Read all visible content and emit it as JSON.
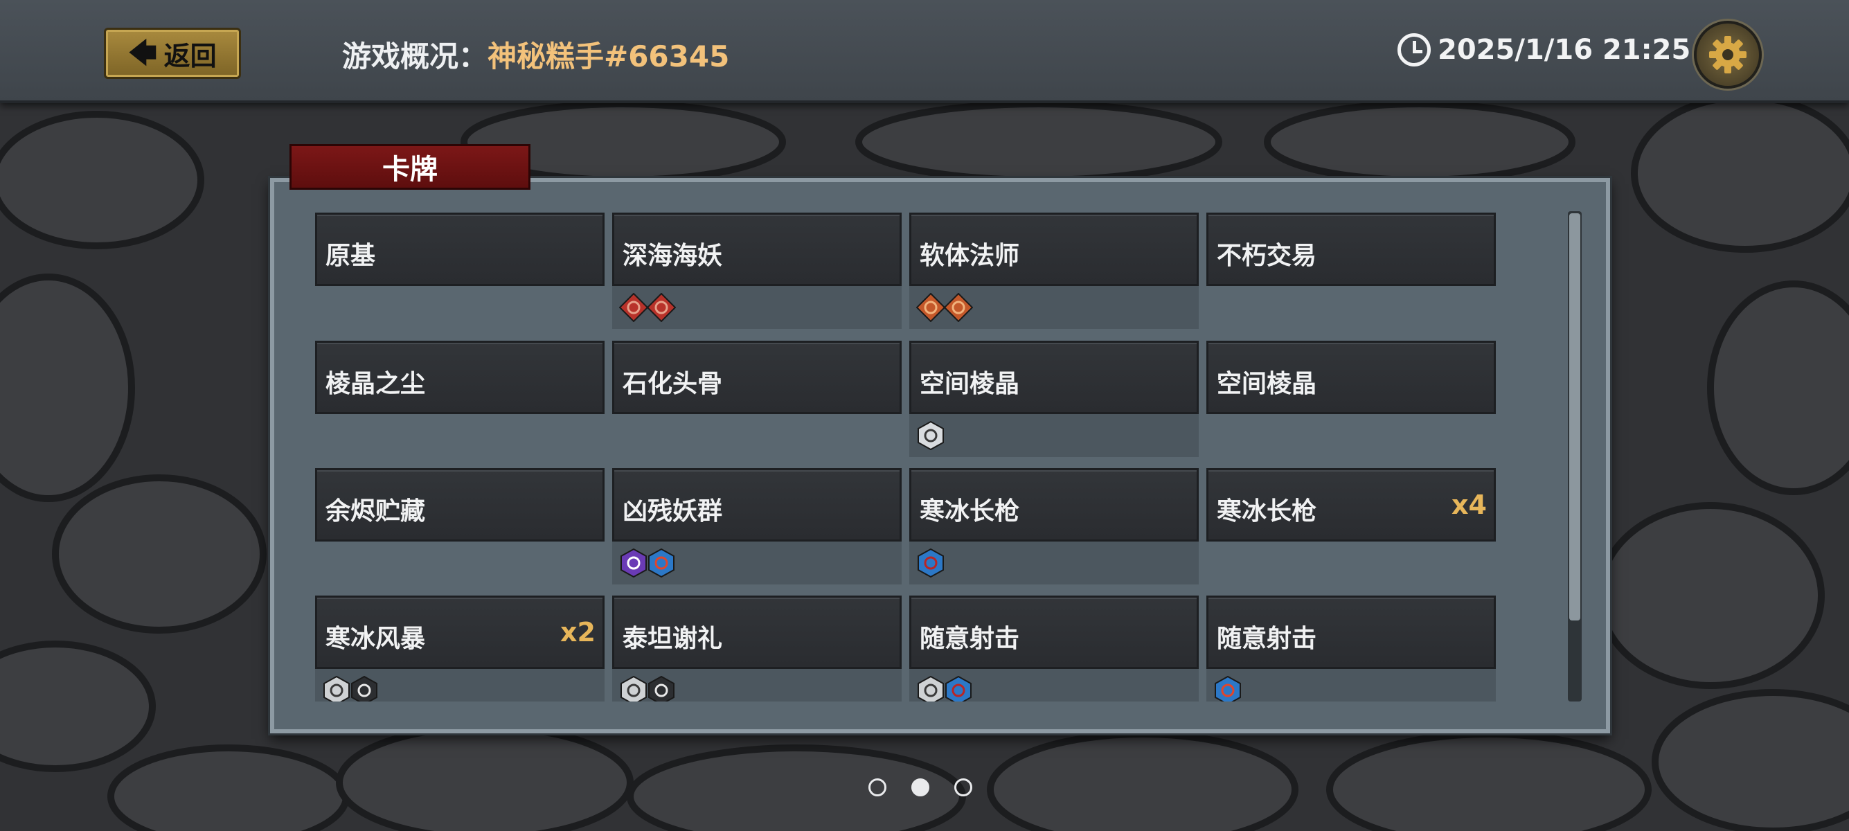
{
  "header": {
    "back_label": "返回",
    "overview_label": "游戏概况：",
    "player_name": "神秘糕手#66345",
    "datetime": "2025/1/16 21:25"
  },
  "panel": {
    "tab_title": "卡牌"
  },
  "cards": [
    {
      "name": "原基",
      "count": "",
      "tags": []
    },
    {
      "name": "深海海妖",
      "count": "",
      "tags": [
        "red-rune-tag",
        "red-rune-tag"
      ]
    },
    {
      "name": "软体法师",
      "count": "",
      "tags": [
        "orange-shield-tag",
        "orange-shield-tag"
      ]
    },
    {
      "name": "不朽交易",
      "count": "",
      "tags": []
    },
    {
      "name": "棱晶之尘",
      "count": "",
      "tags": []
    },
    {
      "name": "石化头骨",
      "count": "",
      "tags": []
    },
    {
      "name": "空间棱晶",
      "count": "",
      "tags": [
        "white-eye-tag"
      ]
    },
    {
      "name": "空间棱晶",
      "count": "",
      "tags": []
    },
    {
      "name": "余烬贮藏",
      "count": "",
      "tags": []
    },
    {
      "name": "凶残妖群",
      "count": "",
      "tags": [
        "purple-hex-tag",
        "blue-fire-hex-tag"
      ]
    },
    {
      "name": "寒冰长枪",
      "count": "",
      "tags": [
        "blue-hex-tag"
      ]
    },
    {
      "name": "寒冰长枪",
      "count": "x4",
      "tags": []
    },
    {
      "name": "寒冰风暴",
      "count": "x2",
      "tags": [
        "white-hex-tag",
        "dark-hex-tag"
      ]
    },
    {
      "name": "泰坦谢礼",
      "count": "",
      "tags": [
        "white-hex-tag",
        "dark-hex-tag"
      ]
    },
    {
      "name": "随意射击",
      "count": "",
      "tags": [
        "white-hex-tag",
        "blue-hex-tag"
      ]
    },
    {
      "name": "随意射击",
      "count": "",
      "tags": [
        "blue-fire-hex-tag"
      ]
    }
  ],
  "pager": {
    "pages": 3,
    "active": 2
  },
  "colors": {
    "accent_gold": "#f3c27b",
    "count_gold": "#e7b65a",
    "title_red": "#7c1717"
  }
}
